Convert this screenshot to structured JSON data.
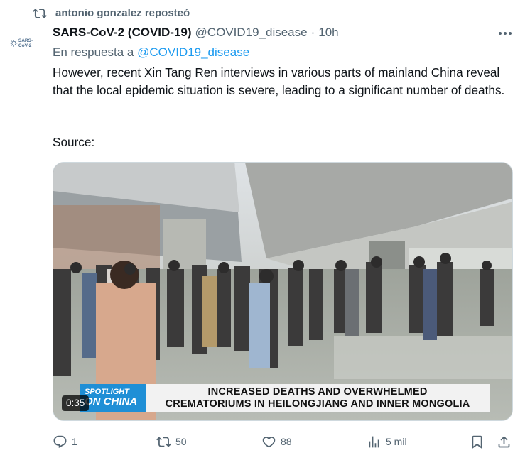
{
  "repost": {
    "icon": "repost-icon",
    "text": "antonio gonzalez reposteó"
  },
  "tweet": {
    "avatar_text": "SARS-CoV-2",
    "author_name": "SARS-CoV-2 (COVID-19)",
    "handle": "@COVID19_disease",
    "separator": "·",
    "time": "10h",
    "reply_prefix": "En respuesta a",
    "reply_mention": "@COVID19_disease",
    "body": "However, recent Xin Tang Ren interviews in various parts of mainland China reveal that the local epidemic situation is severe, leading to a significant number of deaths.",
    "source_label": "Source:"
  },
  "video": {
    "duration": "0:35",
    "banner_spot_line1": "SPOTLIGHT",
    "banner_spot_line2": "ON CHINA",
    "banner_headline_line1": "INCREASED DEATHS AND OVERWHELMED",
    "banner_headline_line2": "CREMATORIUMS IN HEILONGJIANG AND INNER MONGOLIA"
  },
  "actions": {
    "replies": "1",
    "reposts": "50",
    "likes": "88",
    "views": "5 mil"
  },
  "colors": {
    "text_primary": "#0f1419",
    "text_secondary": "#536471",
    "link": "#1d9bf0",
    "border": "#cfd9de"
  }
}
